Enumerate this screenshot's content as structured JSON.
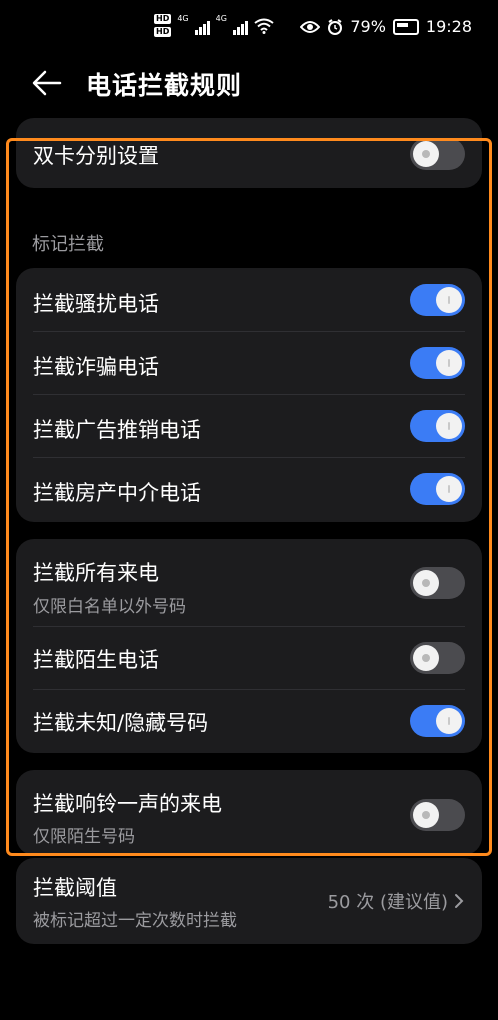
{
  "status_bar": {
    "hd1": "HD",
    "hd2": "HD",
    "net1": "4G",
    "net2": "4G",
    "battery": "79%",
    "time": "19:28"
  },
  "header": {
    "title": "电话拦截规则",
    "back_icon": "arrow-left-icon"
  },
  "dual_card": {
    "label": "双卡分别设置",
    "enabled": false
  },
  "mark_section": {
    "title": "标记拦截",
    "items": [
      {
        "label": "拦截骚扰电话",
        "enabled": true
      },
      {
        "label": "拦截诈骗电话",
        "enabled": true
      },
      {
        "label": "拦截广告推销电话",
        "enabled": true
      },
      {
        "label": "拦截房产中介电话",
        "enabled": true
      }
    ]
  },
  "call_section": {
    "items": [
      {
        "label": "拦截所有来电",
        "sub": "仅限白名单以外号码",
        "enabled": false
      },
      {
        "label": "拦截陌生电话",
        "enabled": false
      },
      {
        "label": "拦截未知/隐藏号码",
        "enabled": true
      }
    ]
  },
  "ring_once": {
    "label": "拦截响铃一声的来电",
    "sub": "仅限陌生号码",
    "enabled": false
  },
  "threshold": {
    "label": "拦截阈值",
    "sub": "被标记超过一定次数时拦截",
    "value": "50 次 (建议值)"
  },
  "colors": {
    "accent": "#3b7cf5",
    "highlight_box": "#ff8a1d",
    "card": "#1c1c1e",
    "background": "#000000"
  }
}
